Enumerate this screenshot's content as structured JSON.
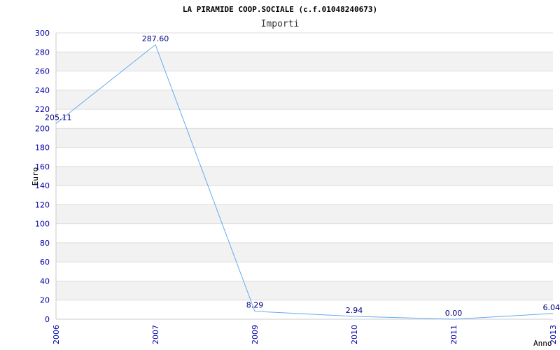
{
  "chart_data": {
    "type": "line",
    "title": "LA PIRAMIDE COOP.SOCIALE (c.f.01048240673)",
    "subtitle": "Importi",
    "xlabel": "Anno",
    "ylabel": "Euro",
    "categories": [
      "2006",
      "2007",
      "2009",
      "2010",
      "2011",
      "2013"
    ],
    "series": [
      {
        "values": [
          205.11,
          287.6,
          8.29,
          2.94,
          0.0,
          6.04
        ]
      }
    ],
    "data_labels": [
      "205.11",
      "287.60",
      "8.29",
      "2.94",
      "0.00",
      "6.04"
    ],
    "ylim": [
      0,
      300
    ],
    "yticks": [
      "0",
      "20",
      "40",
      "60",
      "80",
      "100",
      "120",
      "140",
      "160",
      "180",
      "200",
      "220",
      "240",
      "260",
      "280",
      "300"
    ],
    "grid": true,
    "colors": {
      "line": "#66aaee",
      "band": "#f2f2f2",
      "grid": "#dddddd",
      "tick_text": "#0000aa",
      "label_text": "#000080"
    }
  }
}
